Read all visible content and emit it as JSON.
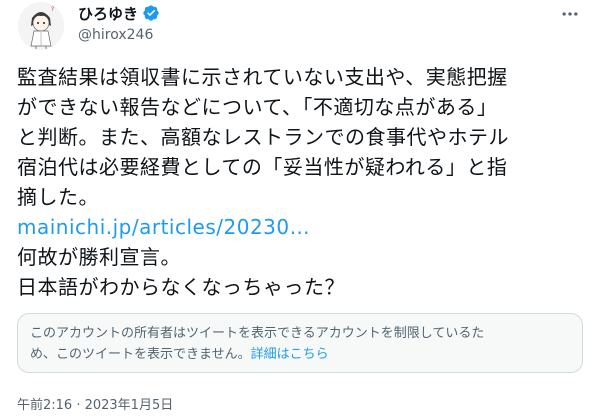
{
  "header": {
    "display_name": "ひろゆき",
    "handle": "@hirox246"
  },
  "icons": {
    "avatar": "avatar-image",
    "verified": "verified-badge-icon",
    "more": "more-options-icon"
  },
  "colors": {
    "accent": "#1d9bf0",
    "text": "#0f1419",
    "secondary": "#536471",
    "notice_bg": "#f7f9f9",
    "notice_border": "#cfd9de"
  },
  "tweet": {
    "lines": [
      "監査結果は領収書に示されていない支出や、実態把握",
      "ができない報告などについて、「不適切な点がある」",
      "と判断。また、高額なレストランでの食事代やホテル",
      "宿泊代は必要経費としての「妥当性が疑われる」と指",
      "摘した。"
    ],
    "link_text": "mainichi.jp/articles/20230…",
    "after_lines": [
      "何故が勝利宣言。",
      "日本語がわからなくなっちゃった？"
    ]
  },
  "notice": {
    "line1": "このアカウントの所有者はツイートを表示できるアカウントを制限しているた",
    "line2": "め、このツイートを表示できません。",
    "link": "詳細はこちら"
  },
  "timestamp": "午前2:16 · 2023年1月5日"
}
